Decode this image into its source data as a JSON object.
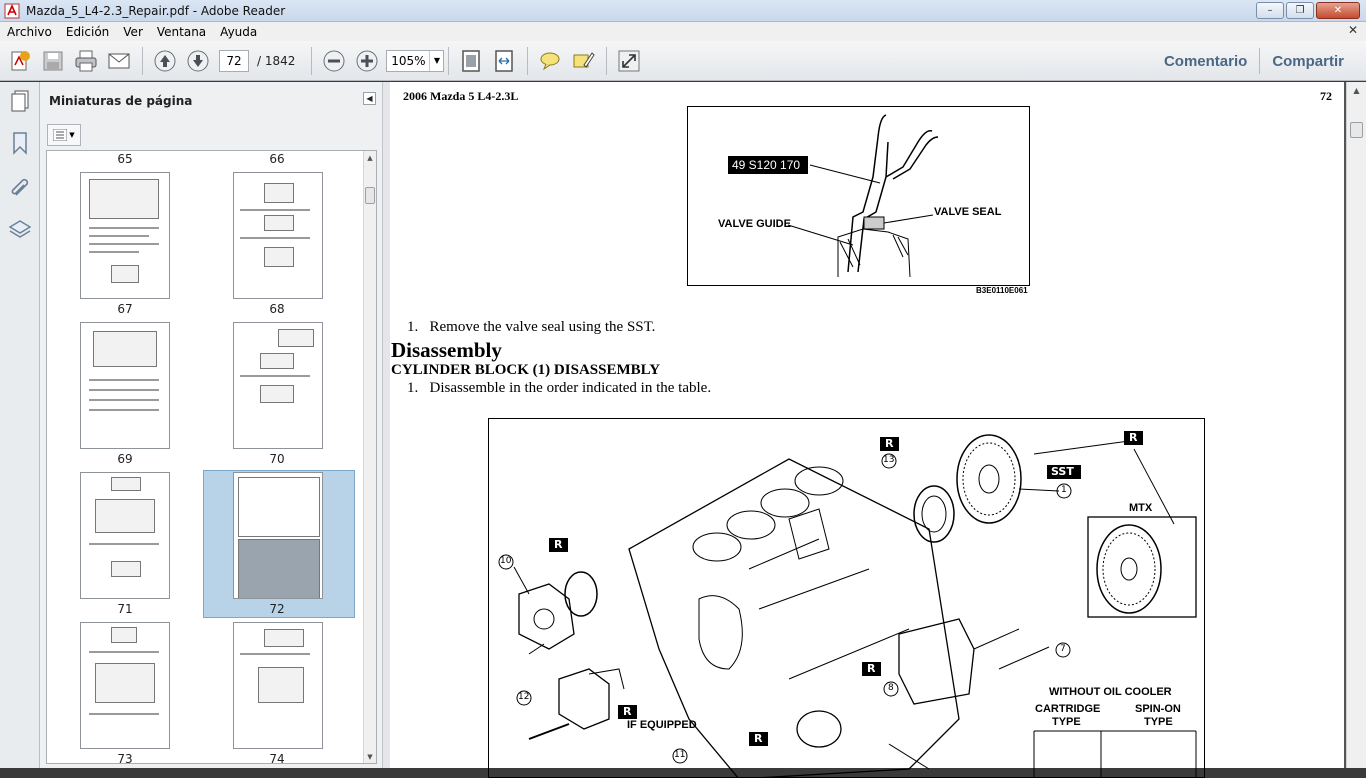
{
  "window": {
    "title": "Mazda_5_L4-2.3_Repair.pdf - Adobe Reader",
    "buttons": {
      "minimize": "–",
      "maximize": "❐",
      "close": "✕"
    }
  },
  "menu": {
    "items": [
      "Archivo",
      "Edición",
      "Ver",
      "Ventana",
      "Ayuda"
    ],
    "close_glyph": "✕"
  },
  "toolbar": {
    "page_number": "72",
    "page_total": "/ 1842",
    "zoom": "105%",
    "comment_label": "Comentario",
    "share_label": "Compartir"
  },
  "panel": {
    "title": "Miniaturas de página",
    "thumbnail_labels": [
      "65",
      "66",
      "67",
      "68",
      "69",
      "70",
      "71",
      "72",
      "73",
      "74"
    ],
    "selected_page": "72"
  },
  "document": {
    "header_left": "2006 Mazda 5 L4-2.3L",
    "header_right": "72",
    "figure1": {
      "tool_label": "49 S120 170",
      "label_valve_guide": "VALVE GUIDE",
      "label_valve_seal": "VALVE SEAL",
      "code": "B3E0110E061"
    },
    "step1": "1.   Remove the valve seal using the SST.",
    "heading": "Disassembly",
    "subheading": "CYLINDER BLOCK (1) DISASSEMBLY",
    "step2": "1.   Disassemble in the order indicated in the table.",
    "figure2": {
      "callouts": [
        "13",
        "1",
        "10",
        "7",
        "8",
        "12",
        "11"
      ],
      "badge_r": "R",
      "badge_sst": "SST",
      "label_mtx": "MTX",
      "label_if_equipped": "IF EQUIPPED",
      "label_without_oil_cooler": "WITHOUT OIL COOLER",
      "label_cartridge": "CARTRIDGE",
      "label_type": "TYPE",
      "label_spin_on": "SPIN-ON"
    }
  }
}
